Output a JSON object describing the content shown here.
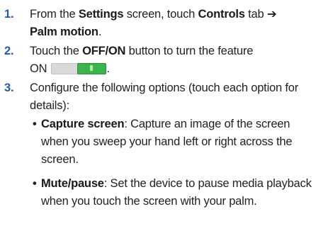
{
  "steps": [
    {
      "number": "1.",
      "line1_a": "From the ",
      "line1_b": "Settings",
      "line1_c": " screen, touch ",
      "line1_d": "Controls",
      "line1_e": " tab ➔",
      "line2": "Palm motion",
      "line2_end": "."
    },
    {
      "number": "2.",
      "line1_a": "Touch the ",
      "line1_b": "OFF/ON",
      "line1_c": " button to turn the feature",
      "line2": "ON",
      "line2_end": ".",
      "toggle_icon": "on-off-toggle-icon"
    },
    {
      "number": "3.",
      "line1": "Configure the following options (touch each option for",
      "line2": "details):"
    }
  ],
  "options": [
    {
      "bullet": "•",
      "name": "Capture screen",
      "sep": ": Capture an image of the screen",
      "line2": "when you sweep your hand left or right across the",
      "line3": "screen."
    },
    {
      "bullet": "•",
      "name": "Mute/pause",
      "sep": ": Set the device to pause media playback",
      "line2": "when you touch the screen with your palm."
    }
  ],
  "colors": {
    "step_number": "#1f5ba8",
    "toggle_on": "#39b54a",
    "toggle_off": "#d9d9d9"
  }
}
